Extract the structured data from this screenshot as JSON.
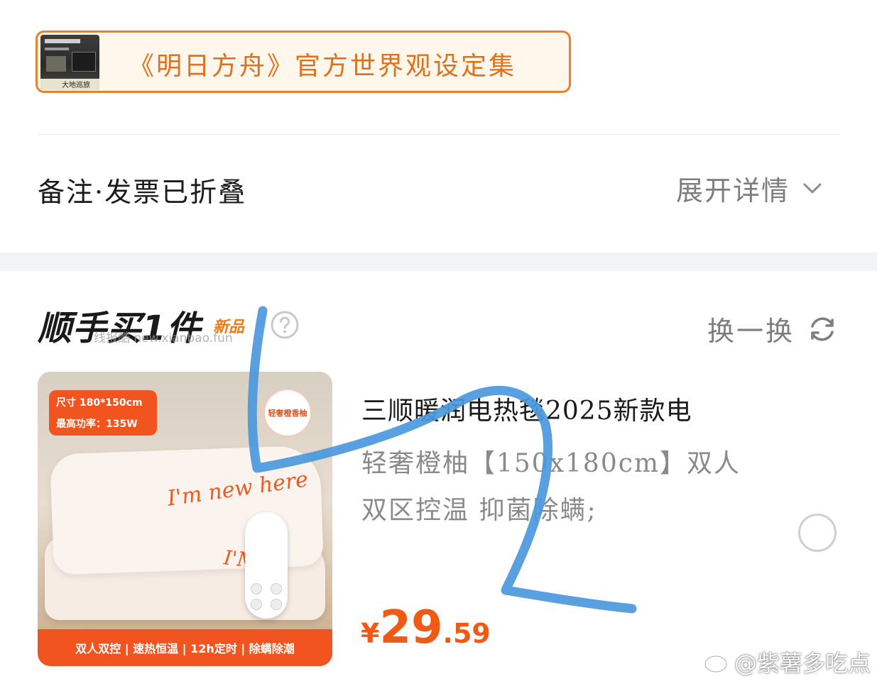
{
  "gift_card": {
    "title": "《明日方舟》官方世界观设定集",
    "thumbnail_text": "大地巡旅"
  },
  "notes": {
    "label": "备注·发票已折叠",
    "expand_label": "展开详情",
    "expand_icon": "chevron-down-icon"
  },
  "bundle": {
    "title": "顺手买1件",
    "new_tag": "新品",
    "help_icon": "question-circle-icon",
    "swap_label": "换一换",
    "swap_icon": "refresh-icon",
    "watermark": "线报酷 new.xianbao.fun"
  },
  "product": {
    "image": {
      "size_label": "尺寸 180*150cm",
      "power_label": "最高功率：135W",
      "badge": "轻奢橙香柚",
      "blanket_text_1": "I'm new here",
      "blanket_text_2": "I'M ne",
      "banner": "双人双控 | 速热恒温 | 12h定时 | 除螨除潮"
    },
    "title": "三顺暖润电热毯2025新款电",
    "desc_line_1": "轻奢橙柚【150x180cm】双人",
    "desc_line_2": "双区控温 抑菌除螨;",
    "price_currency": "¥",
    "price_integer": "29",
    "price_decimal": ".59",
    "selected": false
  },
  "footer": {
    "watermark": "@紫薯多吃点"
  },
  "colors": {
    "accent_orange": "#f05a14",
    "gift_border": "#e5822e",
    "scribble_blue": "#4a98dc"
  }
}
